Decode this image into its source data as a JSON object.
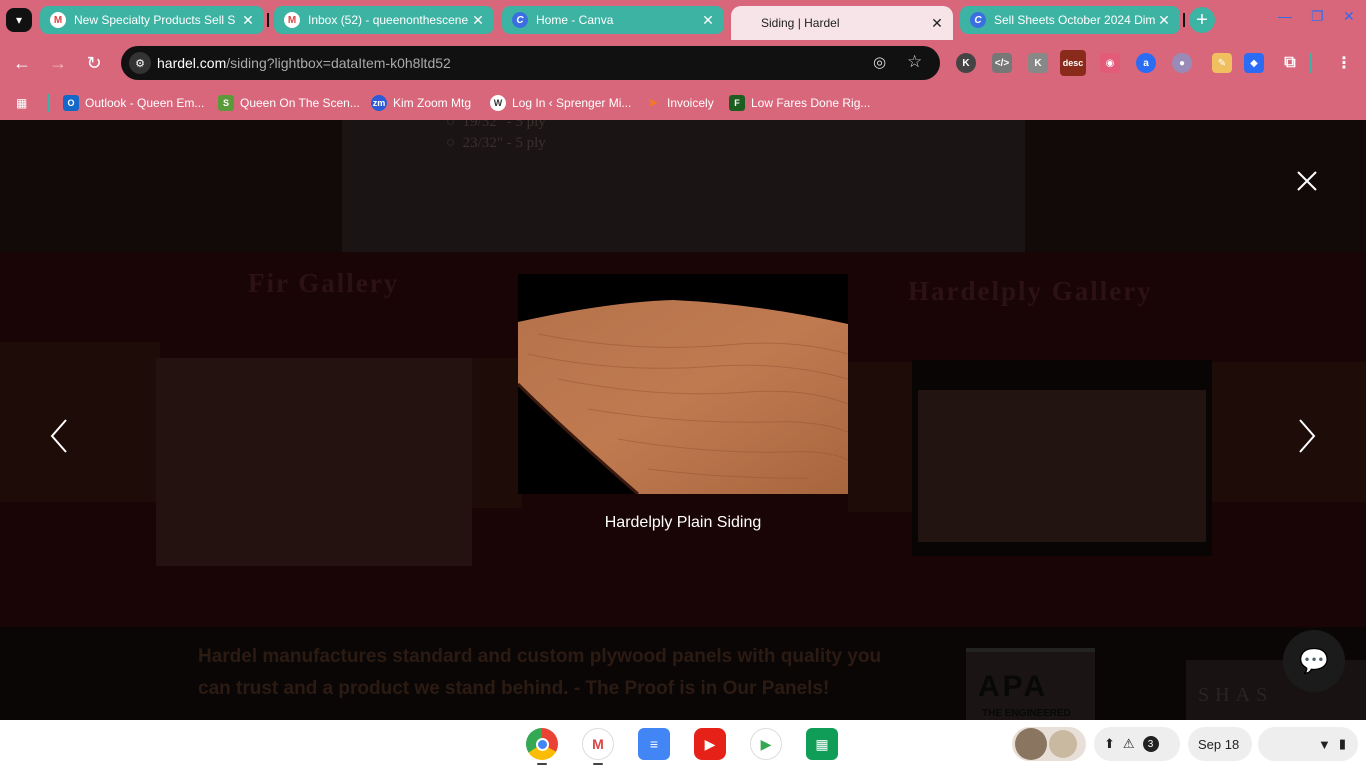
{
  "browser": {
    "tabs": [
      {
        "title": "New Specialty Products Sell S",
        "icon": "gmail-icon",
        "close": "✕"
      },
      {
        "title": "Inbox (52) - queenonthescene",
        "icon": "gmail-icon",
        "close": "✕"
      },
      {
        "title": "Home - Canva",
        "icon": "canva-icon",
        "close": "✕"
      },
      {
        "title": "Siding | Hardel",
        "icon": "none",
        "close": "✕"
      },
      {
        "title": "Sell Sheets October 2024 Dim",
        "icon": "canva-icon",
        "close": "✕"
      }
    ],
    "new_tab": "+",
    "url_host": "hardel.com",
    "url_path": "/siding?lightbox=dataItem-k0h8ltd52",
    "extension_desc_label": "desc",
    "bookmarks": [
      {
        "label": "Outlook - Queen Em...",
        "icon": "outlook-icon"
      },
      {
        "label": "Queen On The Scen...",
        "icon": "shopify-icon"
      },
      {
        "label": "Kim Zoom Mtg",
        "icon": "zoom-icon"
      },
      {
        "label": "Log In ‹ Sprenger Mi...",
        "icon": "wordpress-icon"
      },
      {
        "label": "Invoicely",
        "icon": "invoicely-icon"
      },
      {
        "label": "Low Fares Done Rig...",
        "icon": "frontier-icon"
      }
    ],
    "colors": {
      "frame": "#d8677c",
      "active_tab": "#f7e4e8",
      "grouped_tab": "#3db3a3"
    }
  },
  "page": {
    "background_bullets": [
      "19/32\" - 5 ply",
      "23/32\" - 5 ply"
    ],
    "fir_gallery_title": "Fir Gallery",
    "hardelply_gallery_title": "Hardelply Gallery",
    "footer_text": "Hardel manufactures standard and custom plywood panels with quality you can trust and a product we stand behind. - The Proof is in Our Panels!",
    "apa_logo_text": "APA",
    "apa_logo_subtext": "THE ENGINEERED",
    "shasta_logo_text": "SHAS"
  },
  "lightbox": {
    "caption": "Hardelply Plain Siding",
    "close_icon": "close-icon",
    "prev_icon": "chevron-left-icon",
    "next_icon": "chevron-right-icon"
  },
  "shelf": {
    "apps": [
      "chrome-icon",
      "gmail-icon",
      "docs-icon",
      "youtube-icon",
      "play-store-icon",
      "sheets-icon"
    ],
    "notification_count": "3",
    "date": "Sep 18"
  }
}
